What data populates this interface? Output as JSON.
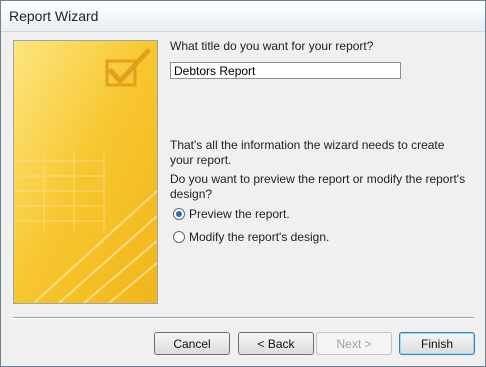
{
  "window": {
    "title": "Report Wizard"
  },
  "form": {
    "title_question": "What title do you want for your report?",
    "title_value": "Debtors Report",
    "info_text": "That's all the information the wizard needs to create your report.",
    "preview_question": "Do you want to preview the report or modify the report's design?",
    "options": [
      {
        "label": "Preview the report.",
        "selected": true
      },
      {
        "label": "Modify the report's design.",
        "selected": false
      }
    ]
  },
  "buttons": {
    "cancel": "Cancel",
    "back": "< Back",
    "next": "Next >",
    "finish": "Finish"
  },
  "colors": {
    "art_yellow": "#f7c62f",
    "accent_blue": "#2a6fb3"
  },
  "icons": {
    "wizard_art": "checkbox-checkmark-illustration"
  }
}
